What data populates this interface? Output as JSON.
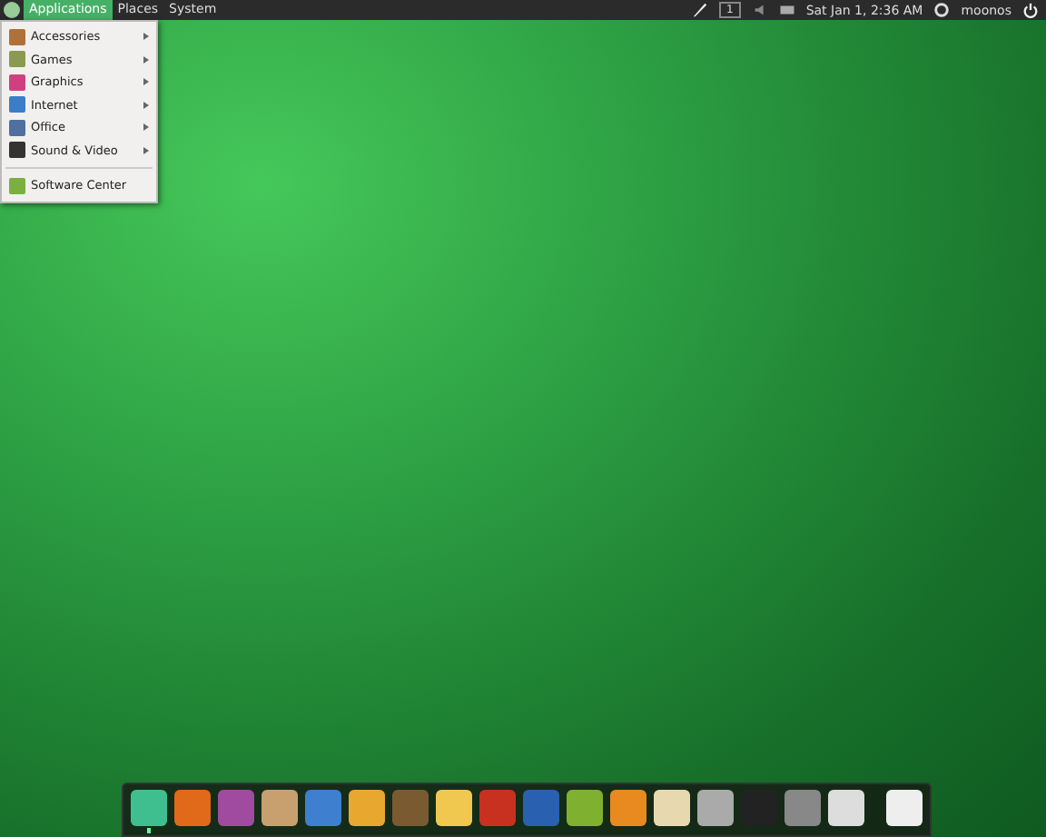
{
  "top_panel": {
    "menus": [
      {
        "label": "Applications",
        "selected": true
      },
      {
        "label": "Places",
        "selected": false
      },
      {
        "label": "System",
        "selected": false
      }
    ],
    "workspace": "1",
    "clock": "Sat Jan 1, 2:36 AM",
    "user": "moonos"
  },
  "applications_menu": {
    "items": [
      {
        "label": "Accessories",
        "has_submenu": true
      },
      {
        "label": "Games",
        "has_submenu": true
      },
      {
        "label": "Graphics",
        "has_submenu": true
      },
      {
        "label": "Internet",
        "has_submenu": true
      },
      {
        "label": "Office",
        "has_submenu": true
      },
      {
        "label": "Sound & Video",
        "has_submenu": true
      }
    ],
    "footer_item": {
      "label": "Software Center",
      "has_submenu": false
    }
  },
  "dock": {
    "items": [
      {
        "running": true
      },
      {
        "running": false
      },
      {
        "running": false
      },
      {
        "running": false
      },
      {
        "running": false
      },
      {
        "running": false
      },
      {
        "running": false
      },
      {
        "running": false
      },
      {
        "running": false
      },
      {
        "running": false
      },
      {
        "running": false
      },
      {
        "running": false
      },
      {
        "running": false
      },
      {
        "running": false
      },
      {
        "running": false
      },
      {
        "running": false
      },
      {
        "running": false
      }
    ]
  }
}
